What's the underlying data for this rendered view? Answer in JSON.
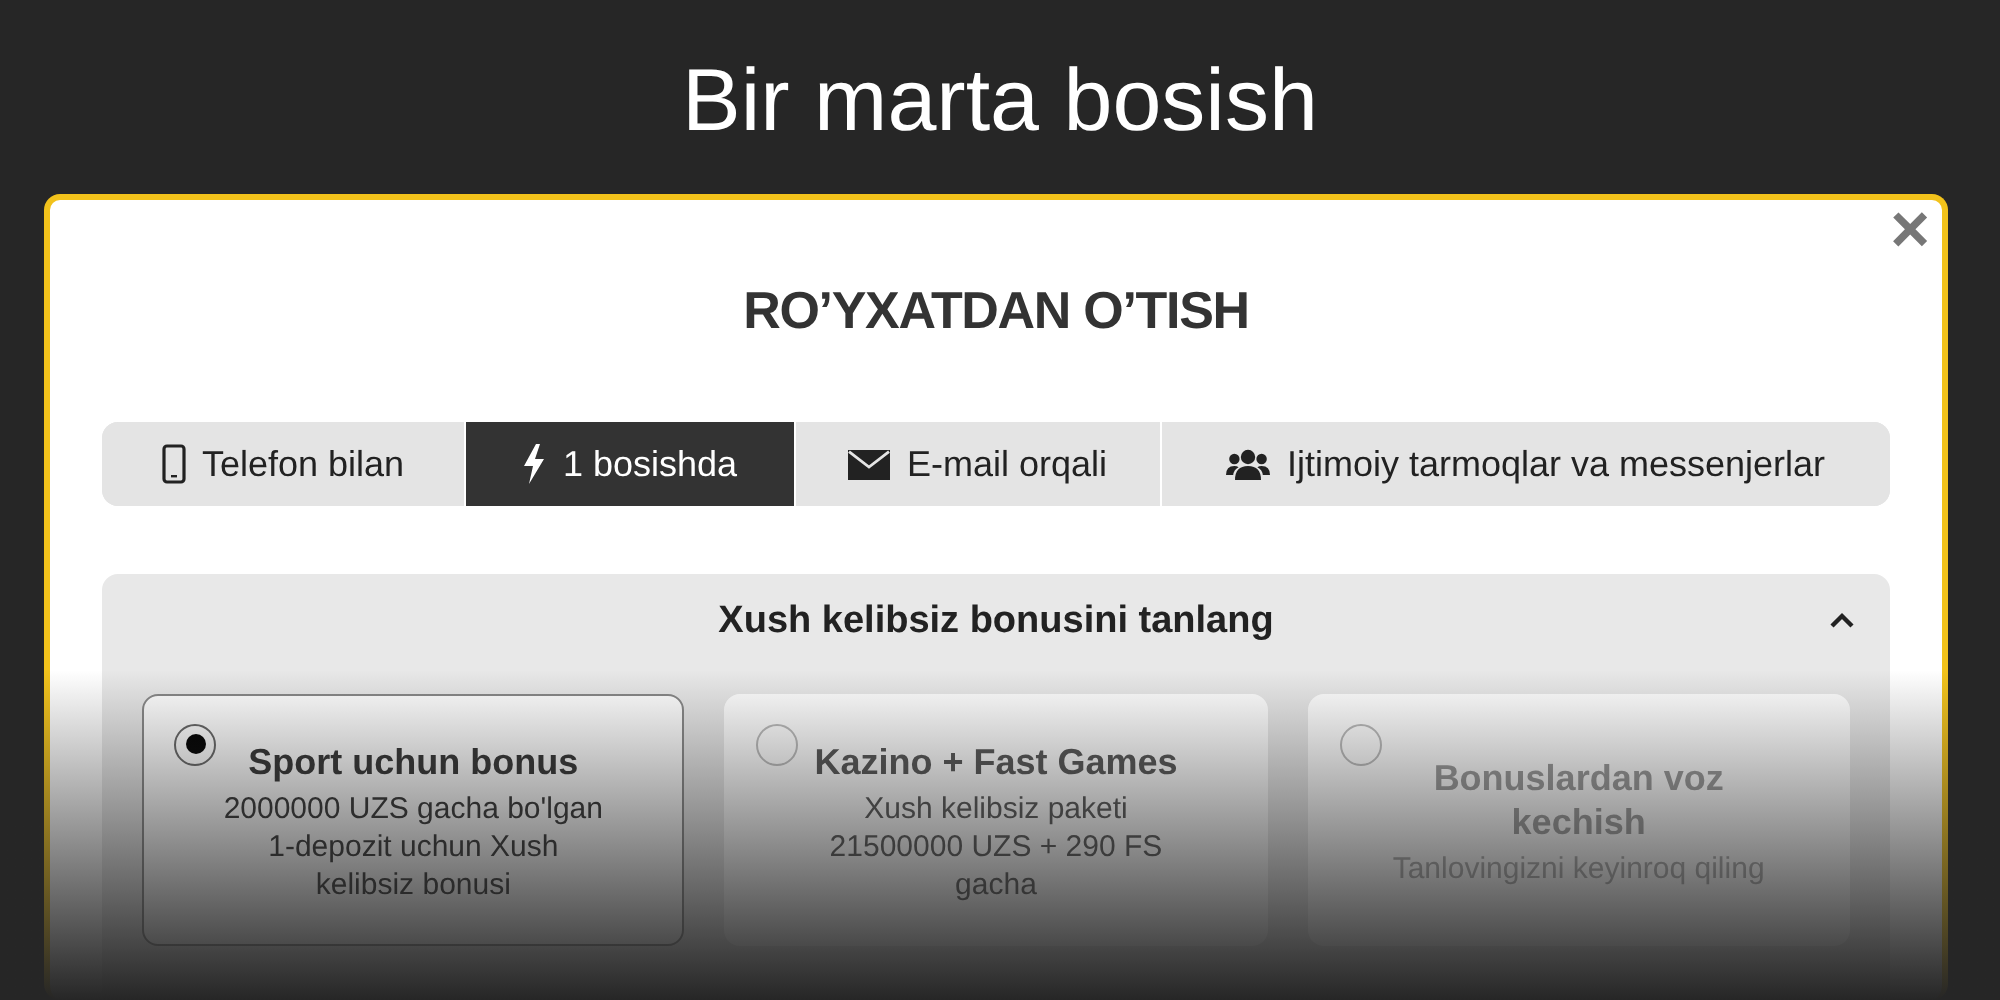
{
  "page_title": "Bir marta bosish",
  "modal": {
    "title": "RO’YXATDAN O’TISH",
    "close": "×",
    "tabs": [
      {
        "label": "Telefon bilan",
        "selected": false
      },
      {
        "label": "1 bosishda",
        "selected": true
      },
      {
        "label": "E-mail orqali",
        "selected": false
      },
      {
        "label": "Ijtimoiy tarmoqlar va messenjerlar",
        "selected": false
      }
    ],
    "bonus_panel": {
      "title": "Xush kelibsiz bonusini tanlang",
      "expanded": true,
      "options": [
        {
          "title": "Sport uchun bonus",
          "description": "2000000 UZS gacha bo'lgan 1-depozit uchun Xush kelibsiz bonusi",
          "selected": true
        },
        {
          "title": "Kazino + Fast Games",
          "description": "Xush kelibsiz paketi 21500000 UZS + 290 FS gacha",
          "selected": false
        },
        {
          "title": "Bonuslardan voz kechish",
          "description": "Tanlovingizni keyinroq qiling",
          "selected": false
        }
      ]
    }
  }
}
